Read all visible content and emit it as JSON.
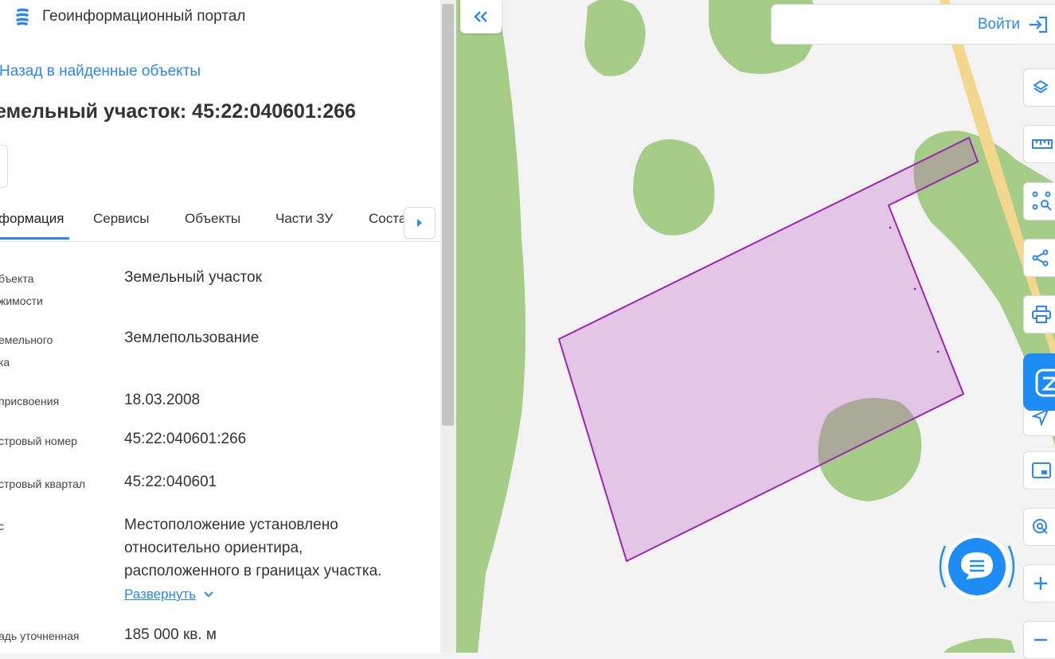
{
  "header": {
    "brand": "Геоинформационный портал"
  },
  "nav": {
    "back": "Назад в найденные объекты"
  },
  "object": {
    "title": "емельный участок: 45:22:040601:266"
  },
  "tabs": [
    "формация",
    "Сервисы",
    "Объекты",
    "Части ЗУ",
    "Соста"
  ],
  "rows": [
    {
      "label": [
        "бъекта",
        "жимости"
      ],
      "value": [
        "Земельный участок"
      ]
    },
    {
      "label": [
        "емельного",
        "ка"
      ],
      "value": [
        "Землепользование"
      ]
    },
    {
      "label": [
        "присвоения"
      ],
      "value": [
        "18.03.2008"
      ]
    },
    {
      "label": [
        "стровый номер"
      ],
      "value": [
        "45:22:040601:266"
      ]
    },
    {
      "label": [
        "стровый квартал"
      ],
      "value": [
        "45:22:040601"
      ]
    },
    {
      "label": [
        "с"
      ],
      "value": [
        "Местоположение установлено",
        "относительно ориентира,",
        "расположенного в границах участка."
      ]
    },
    {
      "label": [
        "адь уточненная"
      ],
      "value": [
        "185 000 кв. м"
      ]
    }
  ],
  "expand_label": "Развернуть",
  "map": {
    "login_label": "Войти",
    "tools": [
      "layers-icon",
      "ruler-icon",
      "select-area-icon",
      "share-icon",
      "print-icon",
      "blue-action-icon",
      "location-arrow-icon",
      "minimap-icon",
      "search-location-icon",
      "zoom-in-icon",
      "zoom-out-icon"
    ]
  },
  "colors": {
    "accent": "#2b87f6",
    "parcel_fill": "#e5c8e6",
    "parcel_stroke": "#9b27b0",
    "forest": "#a5cd88",
    "road": "#f3d78d"
  }
}
